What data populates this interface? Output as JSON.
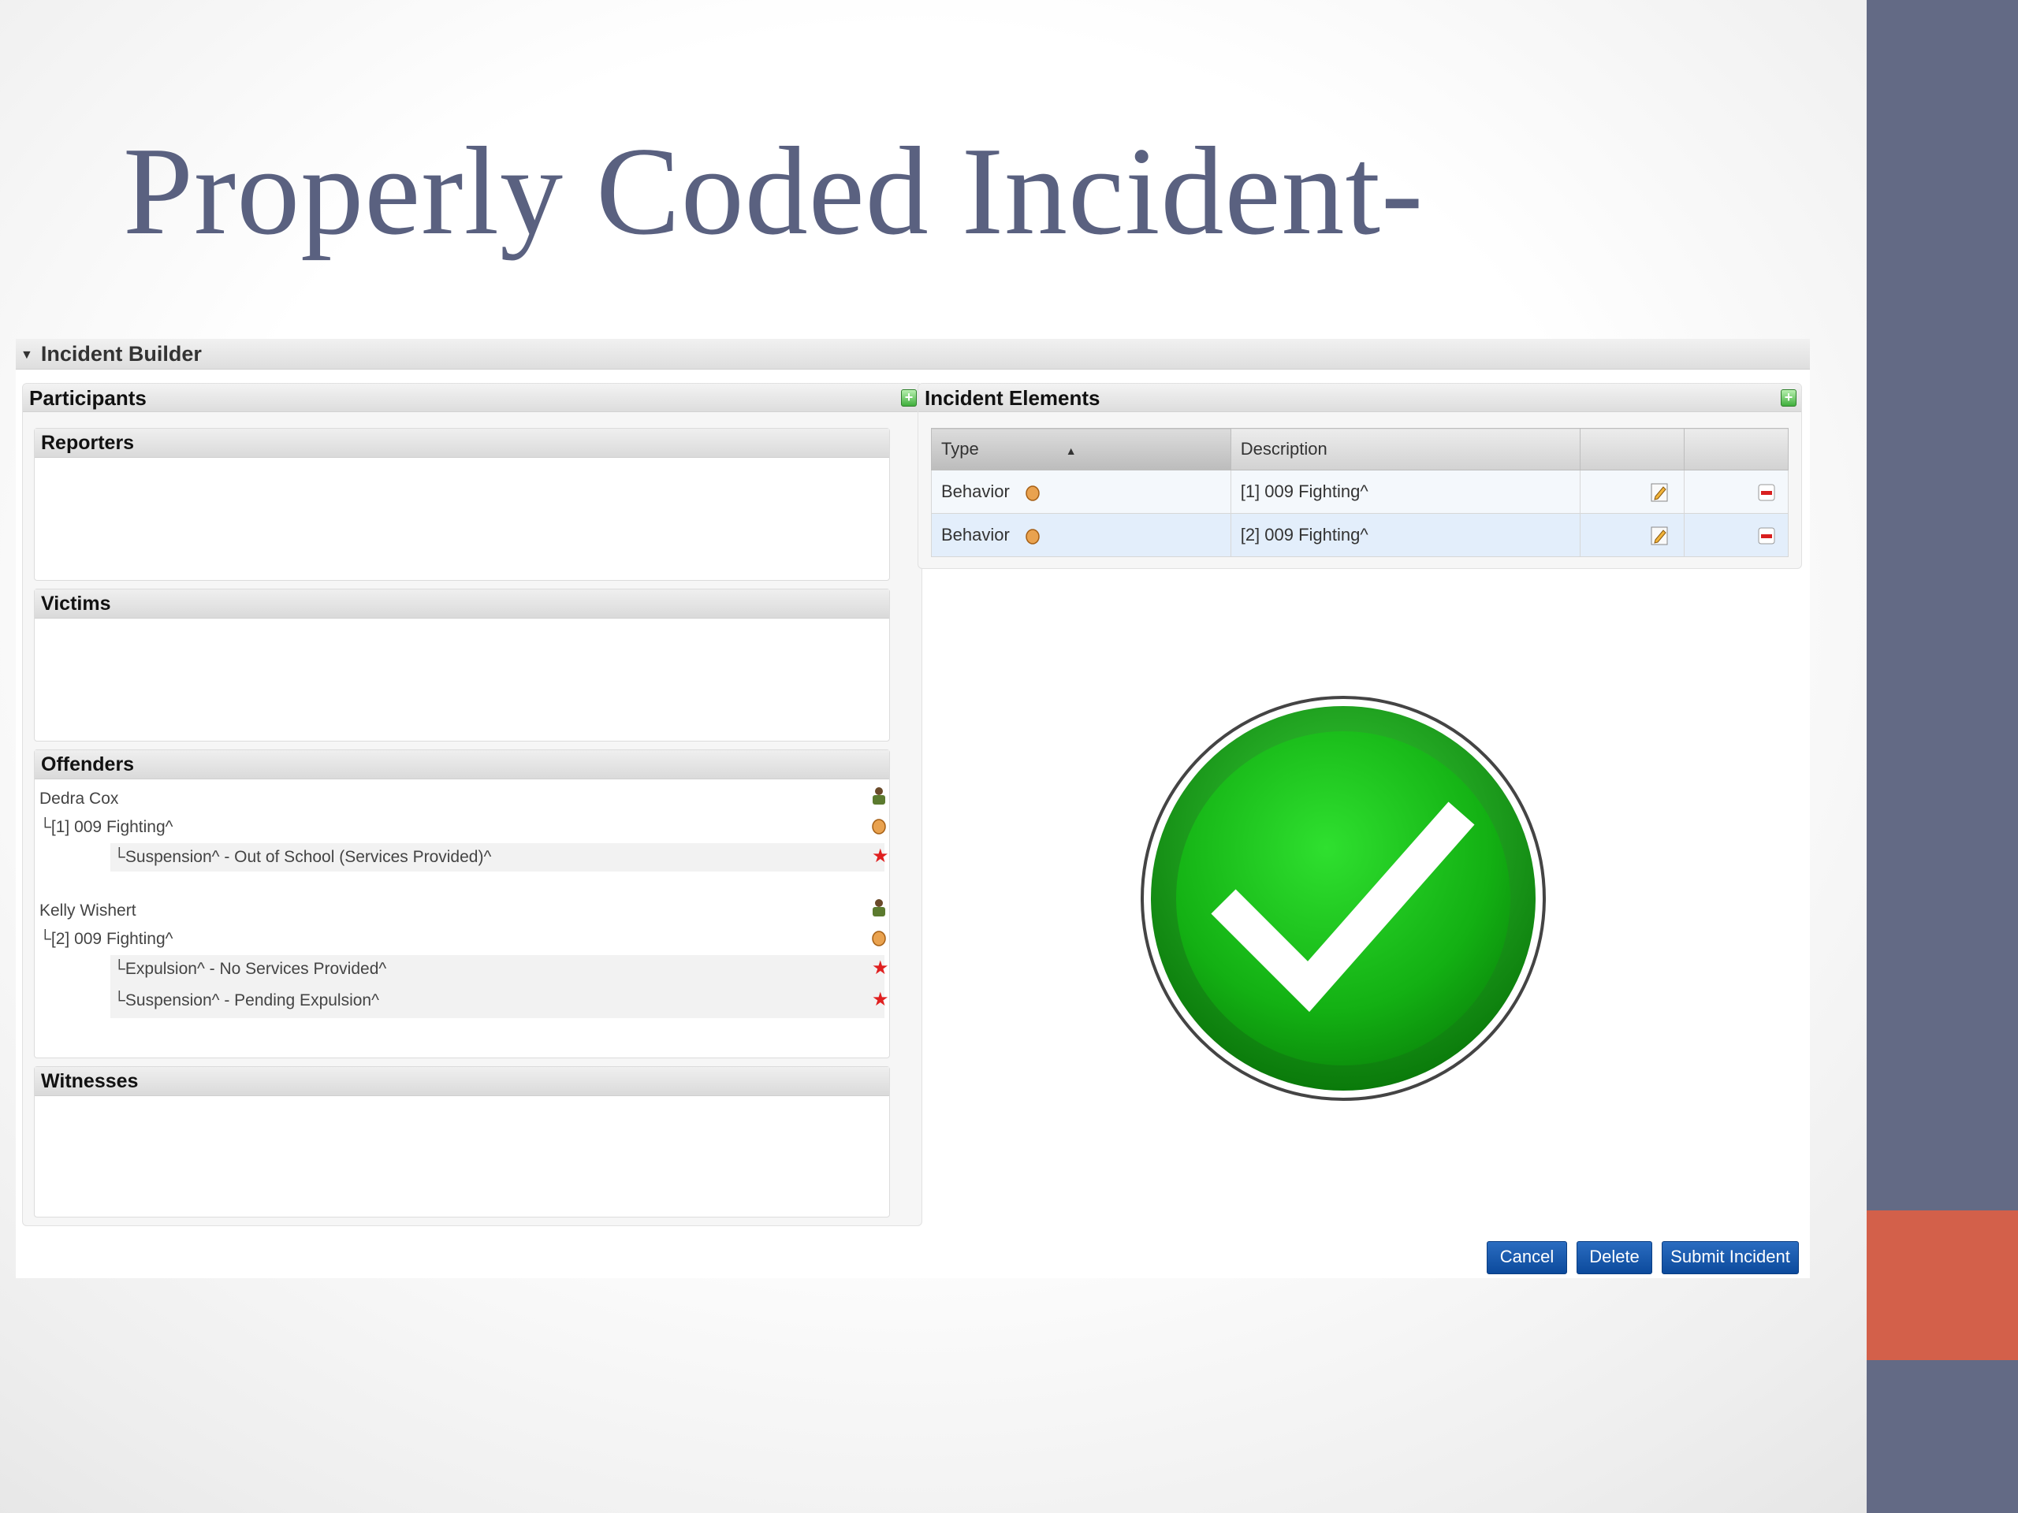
{
  "slide": {
    "title": "Properly Coded Incident-",
    "colors": {
      "side_bar": "#636a85",
      "side_accent": "#d3604a",
      "title": "#5a6180"
    }
  },
  "builder": {
    "header": "Incident Builder",
    "participants": {
      "title": "Participants",
      "reporters": "Reporters",
      "victims": "Victims",
      "offenders": {
        "title": "Offenders",
        "people": [
          {
            "name": "Dedra Cox",
            "incident": "[1] 009 Fighting^",
            "resolutions": [
              "Suspension^ - Out of School (Services Provided)^"
            ]
          },
          {
            "name": "Kelly Wishert",
            "incident": "[2] 009 Fighting^",
            "resolutions": [
              "Expulsion^ - No Services Provided^",
              "Suspension^ - Pending Expulsion^"
            ]
          }
        ]
      },
      "witnesses": "Witnesses"
    },
    "elements": {
      "title": "Incident Elements",
      "columns": {
        "type": "Type",
        "description": "Description"
      },
      "rows": [
        {
          "type": "Behavior",
          "description": "[1] 009 Fighting^"
        },
        {
          "type": "Behavior",
          "description": "[2] 009 Fighting^"
        }
      ]
    },
    "checkmark_icon": "green-checkmark-icon",
    "buttons": {
      "cancel": "Cancel",
      "delete": "Delete",
      "submit": "Submit Incident"
    }
  }
}
